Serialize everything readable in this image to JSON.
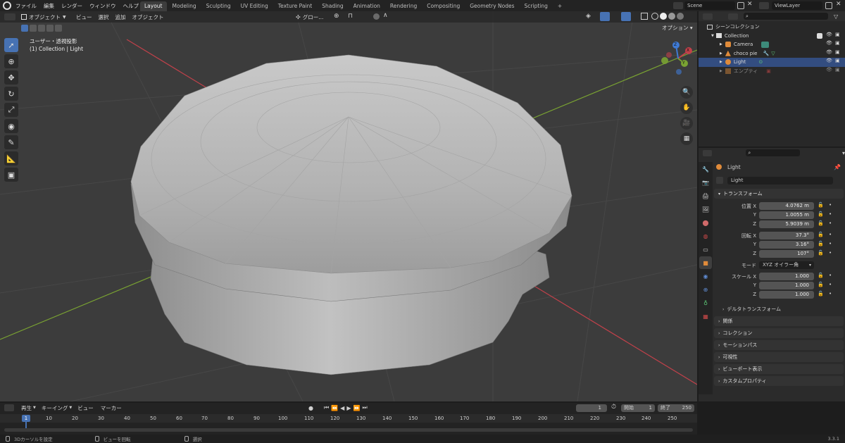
{
  "topbar": {
    "menus": [
      "ファイル",
      "編集",
      "レンダー",
      "ウィンドウ",
      "ヘルプ"
    ],
    "workspaces": [
      "Layout",
      "Modeling",
      "Sculpting",
      "UV Editing",
      "Texture Paint",
      "Shading",
      "Animation",
      "Rendering",
      "Compositing",
      "Geometry Nodes",
      "Scripting"
    ],
    "active_workspace": "Layout",
    "add_tab": "+",
    "scene": "Scene",
    "view_layer": "ViewLayer"
  },
  "viewport": {
    "mode": "オブジェクト",
    "menus": [
      "ビュー",
      "選択",
      "追加",
      "オブジェクト"
    ],
    "transform_orientation": "グロー...",
    "options": "オプション",
    "view_info": "ユーザー・透視投影",
    "collection_info": "(1) Collection | Light",
    "gizmo_axes": [
      "X",
      "Y",
      "Z"
    ],
    "colors": {
      "x_axis": "#c0414a",
      "y_axis": "#7aa332",
      "z_axis": "#3f7ad4",
      "bg": "#3c3c3c"
    }
  },
  "outliner": {
    "root": "シーンコレクション",
    "collection": "Collection",
    "items": [
      {
        "name": "Camera",
        "selected": false
      },
      {
        "name": "choco pie",
        "selected": false
      },
      {
        "name": "Light",
        "selected": true
      },
      {
        "name": "エンプティ",
        "selected": false
      }
    ]
  },
  "properties": {
    "object_name": "Light",
    "data_name": "Light",
    "transform_title": "トランスフォーム",
    "location_label": "位置 X",
    "rotation_label": "回転 X",
    "scale_label": "スケール X",
    "y_label": "Y",
    "z_label": "Z",
    "location": [
      "4.0762 m",
      "1.0055 m",
      "5.9039 m"
    ],
    "rotation": [
      "37.3°",
      "3.16°",
      "107°"
    ],
    "mode_label": "モード",
    "mode_value": "XYZ オイラー角",
    "scale": [
      "1.000",
      "1.000",
      "1.000"
    ],
    "delta_transform": "デルタトランスフォーム",
    "panels": [
      "関係",
      "コレクション",
      "モーションパス",
      "可視性",
      "ビューポート表示",
      "カスタムプロパティ"
    ]
  },
  "timeline": {
    "menus": [
      "再生",
      "キーイング",
      "ビュー",
      "マーカー"
    ],
    "current_frame": "1",
    "start_label": "開始",
    "start": "1",
    "end_label": "終了",
    "end": "250",
    "ticks": [
      "1",
      "10",
      "20",
      "30",
      "40",
      "50",
      "60",
      "70",
      "80",
      "90",
      "100",
      "110",
      "120",
      "130",
      "140",
      "150",
      "160",
      "170",
      "180",
      "190",
      "200",
      "210",
      "220",
      "230",
      "240",
      "250"
    ]
  },
  "statusbar": {
    "hints": [
      "3Dカーソルを設定",
      "ビューを回転",
      "選択"
    ],
    "version": "3.3.1"
  }
}
